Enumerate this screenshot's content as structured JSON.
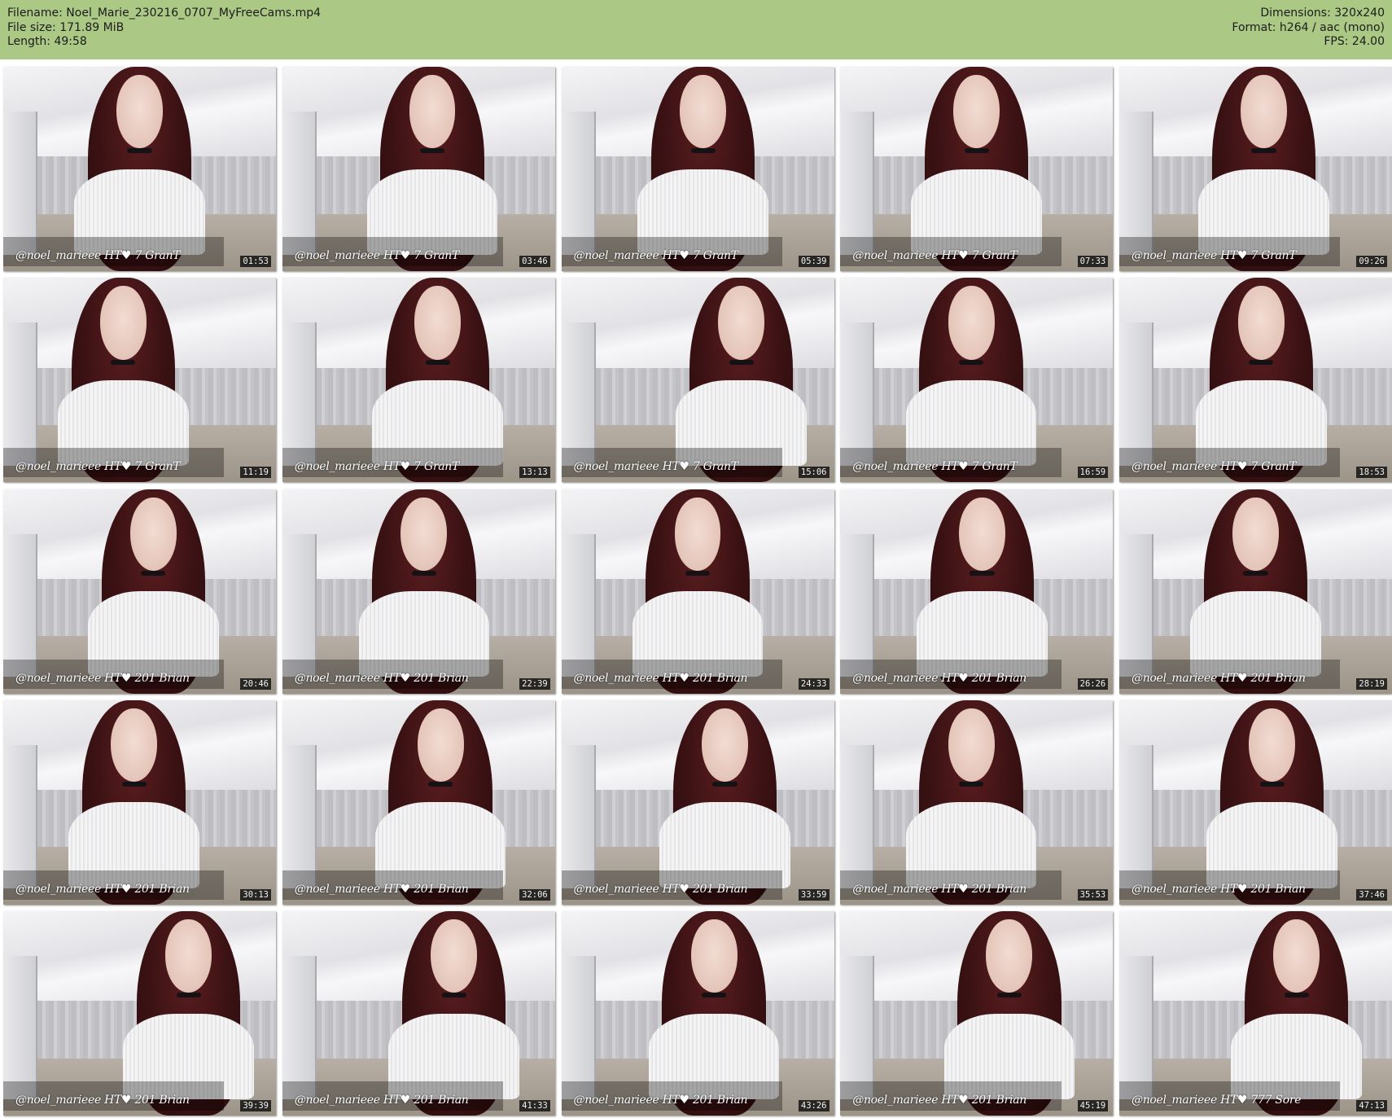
{
  "header": {
    "filename": "Filename: Noel_Marie_230216_0707_MyFreeCams.mp4",
    "filesize": "File size: 171.89 MiB",
    "length": "Length: 49:58",
    "dimensions": "Dimensions: 320x240",
    "format": "Format: h264 / aac (mono)",
    "fps": "FPS: 24.00"
  },
  "colors": {
    "header_bg": "#abc884",
    "timestamp_bg": "#000000"
  },
  "thumbnails": [
    {
      "time": "01:53",
      "overlay": "@noel_marieee HT♥ 7 GranT"
    },
    {
      "time": "03:46",
      "overlay": "@noel_marieee HT♥ 7 GranT"
    },
    {
      "time": "05:39",
      "overlay": "@noel_marieee HT♥ 7 GranT"
    },
    {
      "time": "07:33",
      "overlay": "@noel_marieee HT♥ 7 GranT"
    },
    {
      "time": "09:26",
      "overlay": "@noel_marieee HT♥ 7 GranT"
    },
    {
      "time": "11:19",
      "overlay": "@noel_marieee HT♥ 7 GranT"
    },
    {
      "time": "13:13",
      "overlay": "@noel_marieee HT♥ 7 GranT"
    },
    {
      "time": "15:06",
      "overlay": "@noel_marieee HT♥ 7 GranT"
    },
    {
      "time": "16:59",
      "overlay": "@noel_marieee HT♥ 7 GranT"
    },
    {
      "time": "18:53",
      "overlay": "@noel_marieee HT♥ 7 GranT"
    },
    {
      "time": "20:46",
      "overlay": "@noel_marieee HT♥ 201 Brian"
    },
    {
      "time": "22:39",
      "overlay": "@noel_marieee HT♥ 201 Brian"
    },
    {
      "time": "24:33",
      "overlay": "@noel_marieee HT♥ 201 Brian"
    },
    {
      "time": "26:26",
      "overlay": "@noel_marieee HT♥ 201 Brian"
    },
    {
      "time": "28:19",
      "overlay": "@noel_marieee HT♥ 201 Brian"
    },
    {
      "time": "30:13",
      "overlay": "@noel_marieee HT♥ 201 Brian"
    },
    {
      "time": "32:06",
      "overlay": "@noel_marieee HT♥ 201 Brian"
    },
    {
      "time": "33:59",
      "overlay": "@noel_marieee HT♥ 201 Brian"
    },
    {
      "time": "35:53",
      "overlay": "@noel_marieee HT♥ 201 Brian"
    },
    {
      "time": "37:46",
      "overlay": "@noel_marieee HT♥ 201 Brian"
    },
    {
      "time": "39:39",
      "overlay": "@noel_marieee HT♥ 201 Brian"
    },
    {
      "time": "41:33",
      "overlay": "@noel_marieee HT♥ 201 Brian"
    },
    {
      "time": "43:26",
      "overlay": "@noel_marieee HT♥ 201 Brian"
    },
    {
      "time": "45:19",
      "overlay": "@noel_marieee HT♥ 201 Brian"
    },
    {
      "time": "47:13",
      "overlay": "@noel_marieee HT♥ 777 Sore"
    }
  ]
}
